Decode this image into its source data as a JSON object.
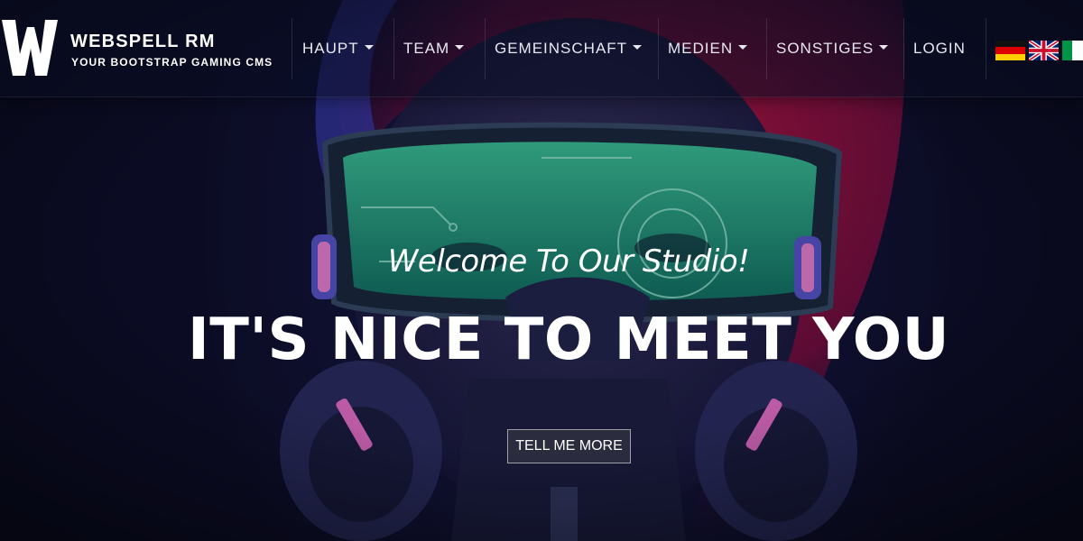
{
  "brand": {
    "name": "WEBSPELL RM",
    "tagline": "YOUR BOOTSTRAP GAMING CMS",
    "logo_icon": "w-logo-icon"
  },
  "nav": {
    "items": [
      {
        "label": "HAUPT",
        "dropdown": true
      },
      {
        "label": "TEAM",
        "dropdown": true
      },
      {
        "label": "GEMEINSCHAFT",
        "dropdown": true
      },
      {
        "label": "MEDIEN",
        "dropdown": true
      },
      {
        "label": "SONSTIGES",
        "dropdown": true
      },
      {
        "label": "LOGIN",
        "dropdown": false
      }
    ],
    "languages": [
      "de-flag-icon",
      "uk-flag-icon",
      "it-flag-icon"
    ]
  },
  "hero": {
    "welcome": "Welcome To Our Studio!",
    "headline": "IT'S NICE TO MEET YOU",
    "button_label": "TELL ME MORE"
  },
  "colors": {
    "accent_green": "#2de0a0",
    "hair_red": "#b0103a",
    "neon_pink": "#ff7ad9",
    "bg_dark": "#0d0f24"
  }
}
